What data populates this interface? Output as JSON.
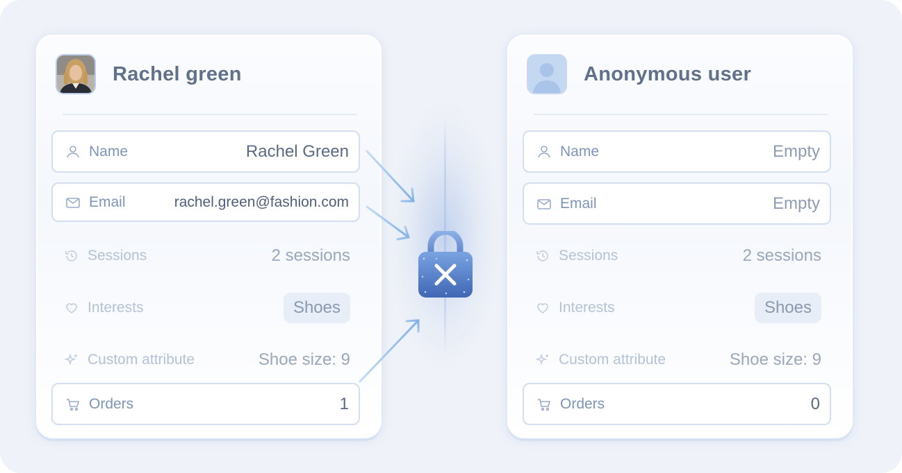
{
  "left_card": {
    "title": "Rachel green",
    "rows": [
      {
        "label": "Name",
        "value": "Rachel Green"
      },
      {
        "label": "Email",
        "value": "rachel.green@fashion.com"
      },
      {
        "label": "Sessions",
        "value": "2 sessions"
      },
      {
        "label": "Interests",
        "value": "Shoes"
      },
      {
        "label": "Custom attribute",
        "value": "Shoe size: 9"
      },
      {
        "label": "Orders",
        "value": "1"
      }
    ]
  },
  "right_card": {
    "title": "Anonymous user",
    "rows": [
      {
        "label": "Name",
        "value": "Empty"
      },
      {
        "label": "Email",
        "value": "Empty"
      },
      {
        "label": "Sessions",
        "value": "2 sessions"
      },
      {
        "label": "Interests",
        "value": "Shoes"
      },
      {
        "label": "Custom attribute",
        "value": "Shoe size: 9"
      },
      {
        "label": "Orders",
        "value": "0"
      }
    ]
  },
  "icons": {
    "name": "user-icon",
    "email": "mail-icon",
    "sessions": "history-icon",
    "interests": "heart-icon",
    "custom": "sparkles-icon",
    "orders": "cart-icon",
    "center": "lock-x-icon"
  },
  "colors": {
    "background": "#eff2f8",
    "accent": "#5b82c6",
    "arrow": "#86b2e6"
  }
}
